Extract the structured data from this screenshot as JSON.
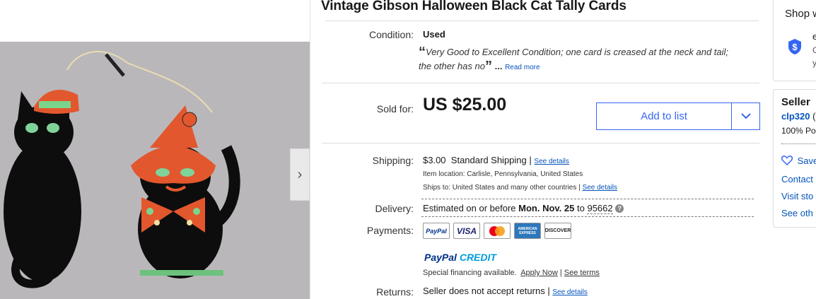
{
  "listing": {
    "title": "Vintage Gibson Halloween Black Cat Tally Cards"
  },
  "gallery": {
    "next_icon": "chevron-right-icon",
    "next_glyph": "›"
  },
  "condition": {
    "label": "Condition:",
    "value": "Used",
    "quote_open": "“",
    "quote_line1": "Very Good to Excellent Condition; one card is creased at the neck and tail;",
    "quote_line2": "the other has no",
    "quote_close": "”",
    "ellipsis": "...",
    "read_more": "Read more"
  },
  "price": {
    "label": "Sold for:",
    "value": "US $25.00",
    "add_to_list": "Add to list"
  },
  "shipping": {
    "label": "Shipping:",
    "cost": "$3.00",
    "method": "Standard Shipping",
    "sep": "|",
    "see_details": "See details",
    "item_location_label": "Item location:",
    "item_location": "Carlisle, Pennsylvania, United States",
    "ships_to_label": "Ships to:",
    "ships_to": "United States and many other countries",
    "ships_sep": "|",
    "ships_see_details": "See details"
  },
  "delivery": {
    "label": "Delivery:",
    "prefix": "Estimated on or before",
    "date": "Mon. Nov. 25",
    "to": "to",
    "zip": "95662",
    "help_icon": "question-icon"
  },
  "payments": {
    "label": "Payments:",
    "badges": [
      "PayPal",
      "VISA",
      "mastercard",
      "AMERICAN EXPRESS",
      "DISCOVER"
    ],
    "paypal_credit_1": "PayPal",
    "paypal_credit_2": "CREDIT",
    "financing": "Special financing available.",
    "apply_now": "Apply Now",
    "sep": "|",
    "see_terms": "See terms"
  },
  "returns": {
    "label": "Returns:",
    "value": "Seller does not accept returns",
    "sep": "|",
    "see_details": "See details"
  },
  "shop_card": {
    "title": "Shop w",
    "icon": "shield-dollar-icon",
    "line1": "e",
    "line2": "G",
    "line3": "y"
  },
  "seller_card": {
    "title": "Seller",
    "seller_id": "clp320",
    "seller_id_tail": "(",
    "feedback": "100% Po",
    "save": "Save",
    "contact": "Contact",
    "visit": "Visit sto",
    "see_other": "See oth"
  },
  "colors": {
    "link": "#0654ba",
    "button_blue": "#3665f3",
    "paypal_dark": "#003087",
    "paypal_light": "#009cde"
  }
}
